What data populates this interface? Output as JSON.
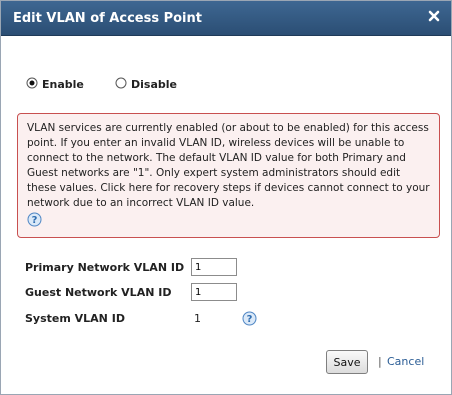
{
  "dialog": {
    "title": "Edit VLAN of Access Point",
    "close_icon": "close-icon"
  },
  "vlan_state": {
    "selected": "Enable",
    "options": [
      "Enable",
      "Disable"
    ]
  },
  "warning": {
    "text": "VLAN services are currently enabled (or about to be enabled) for this access point. If you enter an invalid VLAN ID, wireless devices will be unable to connect to the network. The default VLAN ID value for both Primary and Guest networks are \"1\". Only expert system administrators should edit these values. Click here for recovery steps if devices cannot connect to your network due to an incorrect VLAN ID value.",
    "icon": "help-icon",
    "border_color": "#c85050",
    "background_color": "#fbf0f0"
  },
  "form": {
    "primary": {
      "label": "Primary Network VLAN ID",
      "value": "1"
    },
    "guest": {
      "label": "Guest Network VLAN ID",
      "value": "1"
    },
    "system": {
      "label": "System VLAN ID",
      "value": "1",
      "icon": "help-icon"
    }
  },
  "footer": {
    "save_label": "Save",
    "separator": "|",
    "cancel_label": "Cancel"
  },
  "colors": {
    "titlebar": "#2b4e74",
    "link": "#2b5d95"
  }
}
